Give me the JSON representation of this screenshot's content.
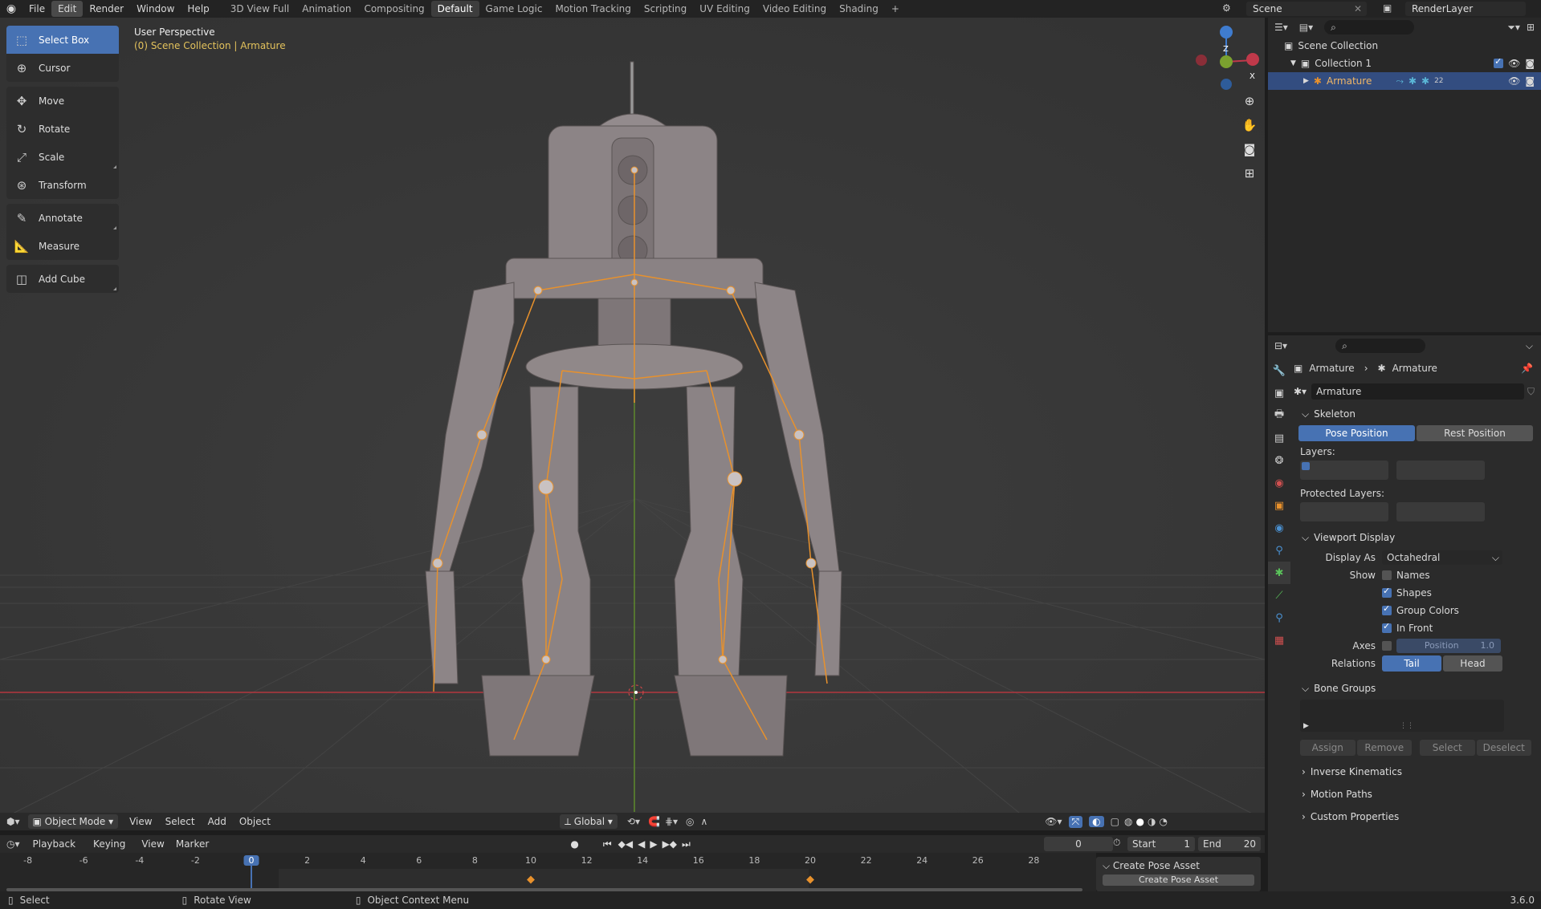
{
  "menu": [
    "File",
    "Edit",
    "Render",
    "Window",
    "Help"
  ],
  "menu_active": "Edit",
  "workspaces": [
    "3D View Full",
    "Animation",
    "Compositing",
    "Default",
    "Game Logic",
    "Motion Tracking",
    "Scripting",
    "UV Editing",
    "Video Editing",
    "Shading",
    "+"
  ],
  "workspace_active": "Default",
  "scene_name": "Scene",
  "render_layer": "RenderLayer",
  "tools": {
    "select_box": "Select Box",
    "cursor": "Cursor",
    "move": "Move",
    "rotate": "Rotate",
    "scale": "Scale",
    "transform": "Transform",
    "annotate": "Annotate",
    "measure": "Measure",
    "add_cube": "Add Cube"
  },
  "viewport": {
    "title": "User Perspective",
    "subtitle": "(0) Scene Collection | Armature",
    "gizmo_x": "X",
    "gizmo_y": "Y",
    "gizmo_z": "Z"
  },
  "vp_header": {
    "mode": "Object Mode",
    "view": "View",
    "select": "Select",
    "add": "Add",
    "object": "Object",
    "orientation": "Global"
  },
  "timeline": {
    "playback": "Playback",
    "keying": "Keying",
    "view": "View",
    "marker": "Marker",
    "current_frame": "0",
    "start_label": "Start",
    "start": "1",
    "end_label": "End",
    "end": "20",
    "ticks": [
      "-8",
      "-6",
      "-4",
      "-2",
      "0",
      "2",
      "4",
      "6",
      "8",
      "10",
      "12",
      "14",
      "16",
      "18",
      "20",
      "22",
      "24",
      "26",
      "28"
    ],
    "keyframes": [
      10,
      20
    ]
  },
  "pose_asset": {
    "header": "Create Pose Asset",
    "button": "Create Pose Asset"
  },
  "outliner": {
    "scene_collection": "Scene Collection",
    "collection": "Collection 1",
    "armature": "Armature",
    "badge": "22"
  },
  "props": {
    "breadcrumb_1": "Armature",
    "breadcrumb_2": "Armature",
    "data_name": "Armature",
    "skeleton": "Skeleton",
    "pose_position": "Pose Position",
    "rest_position": "Rest Position",
    "layers": "Layers:",
    "protected_layers": "Protected Layers:",
    "viewport_display": "Viewport Display",
    "display_as_label": "Display As",
    "display_as": "Octahedral",
    "show_label": "Show",
    "names": "Names",
    "shapes": "Shapes",
    "group_colors": "Group Colors",
    "in_front": "In Front",
    "axes_label": "Axes",
    "position_label": "Position",
    "position_value": "1.0",
    "relations_label": "Relations",
    "tail": "Tail",
    "head": "Head",
    "bone_groups": "Bone Groups",
    "assign": "Assign",
    "remove": "Remove",
    "select": "Select",
    "deselect": "Deselect",
    "inverse_kinematics": "Inverse Kinematics",
    "motion_paths": "Motion Paths",
    "custom_properties": "Custom Properties"
  },
  "status": {
    "select": "Select",
    "rotate_view": "Rotate View",
    "context_menu": "Object Context Menu",
    "version": "3.6.0"
  },
  "colors": {
    "accent": "#4772b3",
    "armature_orange": "#e8912c",
    "grid_red": "#b3373f",
    "grid_green": "#5e8a2c"
  }
}
